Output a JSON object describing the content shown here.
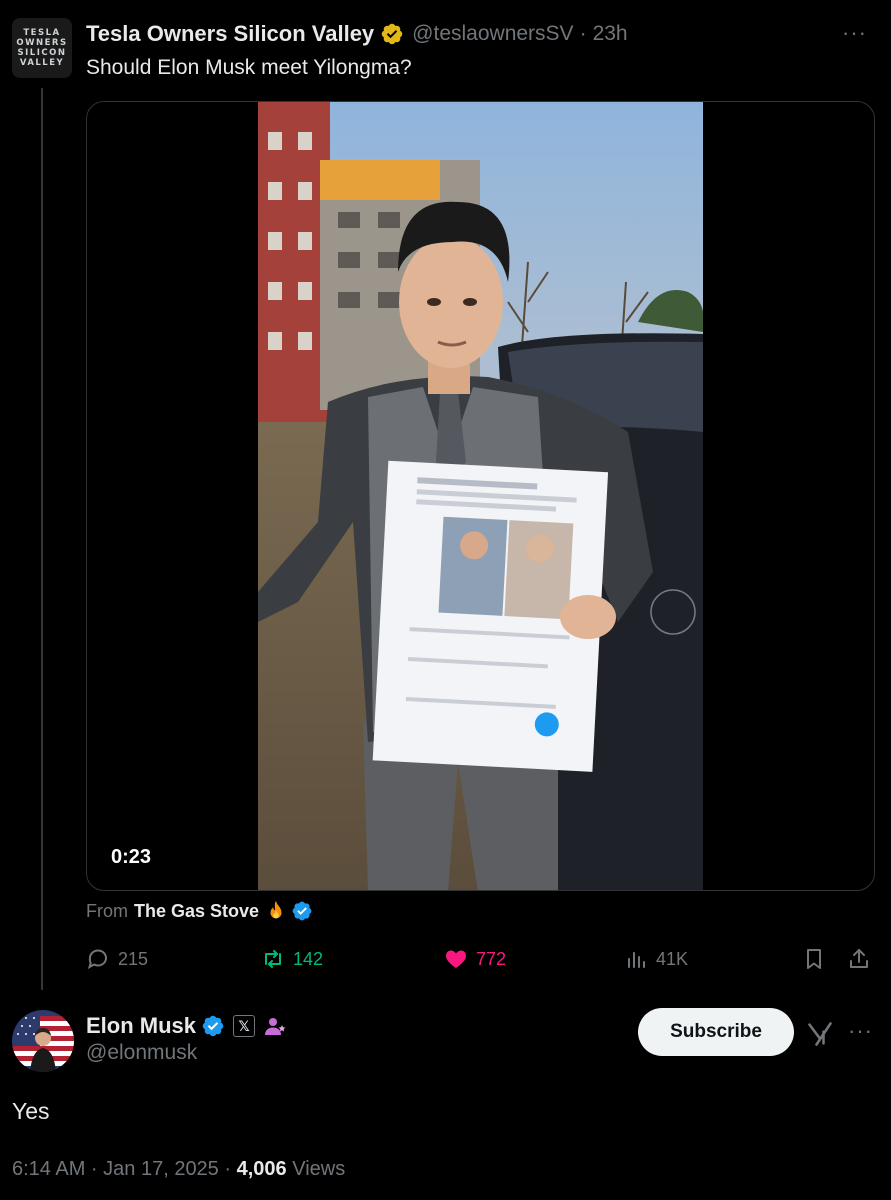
{
  "parent_tweet": {
    "avatar_lines": [
      "TESLA",
      "OWNERS",
      "SILICON",
      "VALLEY"
    ],
    "name": "Tesla Owners Silicon Valley",
    "handle": "@teslaownersSV",
    "separator": "·",
    "time": "23h",
    "more": "···",
    "text": "Should Elon Musk meet Yilongma?",
    "video_duration": "0:23",
    "from_label": "From",
    "from_name": "The Gas Stove",
    "stats": {
      "replies": "215",
      "reposts": "142",
      "likes": "772",
      "views": "41K"
    }
  },
  "reply_tweet": {
    "name": "Elon Musk",
    "handle": "@elonmusk",
    "x_badge": "𝕏",
    "subscribe_label": "Subscribe",
    "more": "···",
    "text": "Yes",
    "time": "6:14 AM · Jan 17, 2025 ·",
    "views_count": "4,006",
    "views_label": "Views"
  },
  "colors": {
    "background": "#000000",
    "text_primary": "#e7e9ea",
    "text_secondary": "#71767b",
    "repost_green": "#00ba7c",
    "like_pink": "#f91880",
    "verified_blue": "#1d9bf0",
    "verified_gold": "#e2b719"
  },
  "icons": {
    "verified_gold": "verified-gold-badge-icon",
    "verified_blue": "verified-blue-badge-icon",
    "reply": "speech-bubble-icon",
    "repost": "repost-arrows-icon",
    "like": "heart-filled-icon",
    "views": "bar-chart-icon",
    "bookmark": "bookmark-icon",
    "share": "share-upload-icon",
    "fire": "fire-emoji-icon",
    "grok": "grok-icon",
    "affiliate": "affiliate-people-icon"
  }
}
